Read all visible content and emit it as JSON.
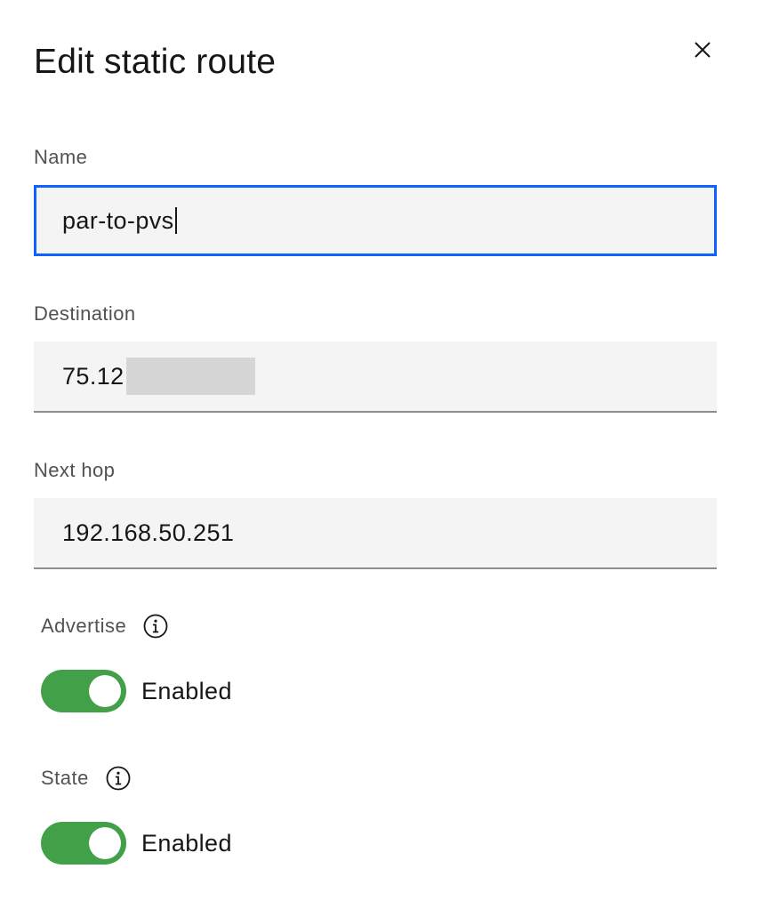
{
  "modal": {
    "title": "Edit static route",
    "close_icon": "close-icon"
  },
  "fields": {
    "name": {
      "label": "Name",
      "value": "par-to-pvs"
    },
    "destination": {
      "label": "Destination",
      "value": "75.12"
    },
    "next_hop": {
      "label": "Next hop",
      "value": "192.168.50.251"
    }
  },
  "toggles": {
    "advertise": {
      "label": "Advertise",
      "icon": "info-icon",
      "state_text": "Enabled",
      "enabled": true
    },
    "state": {
      "label": "State",
      "icon": "info-icon",
      "state_text": "Enabled",
      "enabled": true
    }
  },
  "colors": {
    "focus_border": "#0f62fe",
    "toggle_on": "#42a048",
    "field_background": "#f4f4f4"
  }
}
